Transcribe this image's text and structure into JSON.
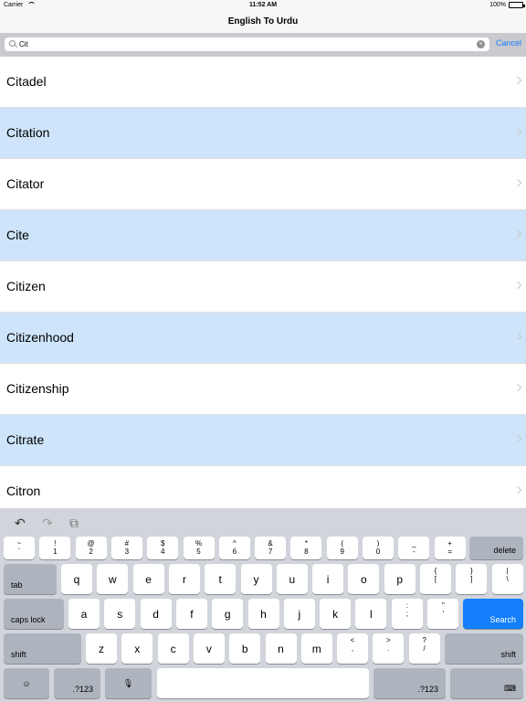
{
  "status_bar": {
    "carrier": "Carrier",
    "time": "11:52 AM",
    "battery": "100%"
  },
  "nav": {
    "title": "English To Urdu"
  },
  "search": {
    "value": "Cit",
    "cancel_label": "Cancel"
  },
  "results": [
    "Citadel",
    "Citation",
    "Citator",
    "Cite",
    "Citizen",
    "Citizenhood",
    "Citizenship",
    "Citrate",
    "Citron"
  ],
  "toolbar": {
    "undo": "↶",
    "redo": "↷",
    "paste": "⧉"
  },
  "keyboard": {
    "row1": [
      {
        "top": "~",
        "bottom": "`"
      },
      {
        "top": "!",
        "bottom": "1"
      },
      {
        "top": "@",
        "bottom": "2"
      },
      {
        "top": "#",
        "bottom": "3"
      },
      {
        "top": "$",
        "bottom": "4"
      },
      {
        "top": "%",
        "bottom": "5"
      },
      {
        "top": "^",
        "bottom": "6"
      },
      {
        "top": "&",
        "bottom": "7"
      },
      {
        "top": "*",
        "bottom": "8"
      },
      {
        "top": "(",
        "bottom": "9"
      },
      {
        "top": ")",
        "bottom": "0"
      },
      {
        "top": "_",
        "bottom": "-"
      },
      {
        "top": "+",
        "bottom": "="
      }
    ],
    "delete_label": "delete",
    "tab_label": "tab",
    "row2": [
      "q",
      "w",
      "e",
      "r",
      "t",
      "y",
      "u",
      "i",
      "o",
      "p"
    ],
    "row2_extra": [
      {
        "top": "{",
        "bottom": "["
      },
      {
        "top": "}",
        "bottom": "]"
      },
      {
        "top": "|",
        "bottom": "\\"
      }
    ],
    "caps_label": "caps lock",
    "row3": [
      "a",
      "s",
      "d",
      "f",
      "g",
      "h",
      "j",
      "k",
      "l"
    ],
    "row3_extra": [
      {
        "top": ":",
        "bottom": ";"
      },
      {
        "top": "\"",
        "bottom": "'"
      }
    ],
    "search_label": "Search",
    "shift_label": "shift",
    "row4": [
      "z",
      "x",
      "c",
      "v",
      "b",
      "n",
      "m"
    ],
    "row4_extra": [
      {
        "top": "<",
        "bottom": ","
      },
      {
        "top": ">",
        "bottom": "."
      },
      {
        "top": "?",
        "bottom": "/"
      }
    ],
    "emoji": "☺",
    "num_label": ".?123",
    "mic": "🎙",
    "hide": "⌨"
  }
}
